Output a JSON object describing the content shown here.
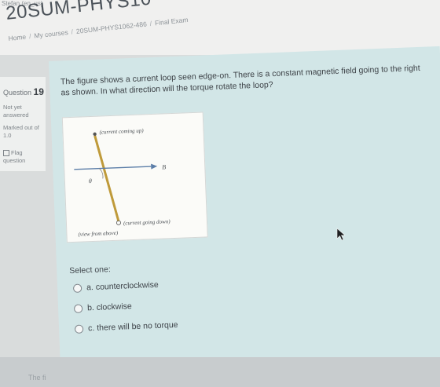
{
  "header": {
    "top_small": "Stefan (en_us)",
    "course_title": "20SUM-PHYS10",
    "breadcrumb": {
      "home": "Home",
      "my_courses": "My courses",
      "course": "20SUM-PHYS1062-486",
      "section": "Final Exam"
    }
  },
  "sidebar": {
    "question_label": "Question",
    "question_number": "19",
    "status_line1": "Not yet",
    "status_line2": "answered",
    "marks_line1": "Marked out of",
    "marks_line2": "1.0",
    "flag_line1": "Flag",
    "flag_line2": "question"
  },
  "question": {
    "text": "The figure shows a current loop seen edge-on. There is a constant magnetic field going to the right as shown. In what direction will the torque rotate the loop?",
    "figure": {
      "label_top": "(current coming up)",
      "label_bottom": "(current going down)",
      "label_b": "B",
      "label_theta": "θ",
      "label_view": "(view from above)"
    },
    "select_one": "Select one:",
    "options": [
      {
        "letter": "a.",
        "text": "counterclockwise"
      },
      {
        "letter": "b.",
        "text": "clockwise"
      },
      {
        "letter": "c.",
        "text": "there will be no torque"
      }
    ]
  },
  "footer": {
    "next_text": "The fi"
  }
}
